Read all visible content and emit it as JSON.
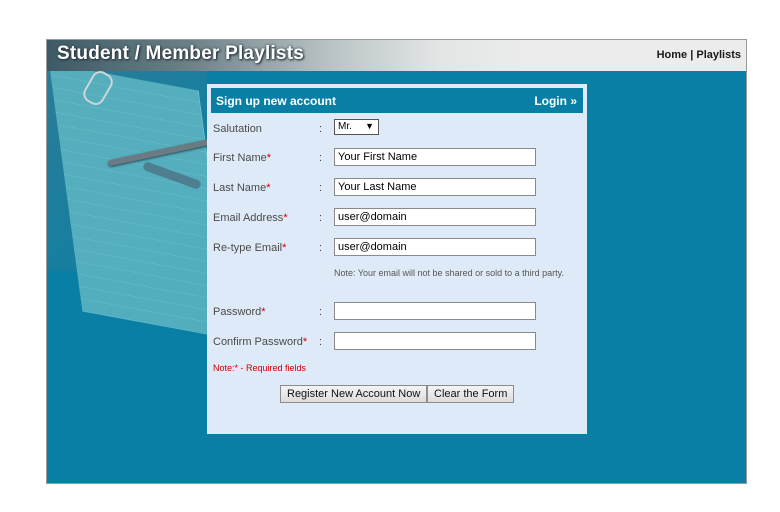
{
  "header": {
    "title": "Student / Member Playlists",
    "nav_home": "Home",
    "nav_separator": "|",
    "nav_playlists": "Playlists"
  },
  "panel": {
    "title": "Sign up new account",
    "login_label": "Login",
    "login_icon": "»"
  },
  "form": {
    "colon": ":",
    "required_marker": "*",
    "salutation": {
      "label": "Salutation",
      "selected": "Mr.",
      "arrow": "▼"
    },
    "first_name": {
      "label": "First Name",
      "value": "Your First Name"
    },
    "last_name": {
      "label": "Last Name",
      "value": "Your Last Name"
    },
    "email": {
      "label": "Email Address",
      "value": "user@domain"
    },
    "retype_email": {
      "label": "Re-type Email",
      "value": "user@domain"
    },
    "email_note": "Note: Your email will not be shared or sold to a third party.",
    "password": {
      "label": "Password",
      "value": ""
    },
    "confirm_password": {
      "label": "Confirm Password",
      "value": ""
    },
    "required_note": "Note:* - Required fields",
    "register_button": "Register New Account Now",
    "clear_button": "Clear the Form"
  },
  "colors": {
    "background": "#0a7fa6",
    "panel": "#deeaf7",
    "required": "#cc0000"
  }
}
